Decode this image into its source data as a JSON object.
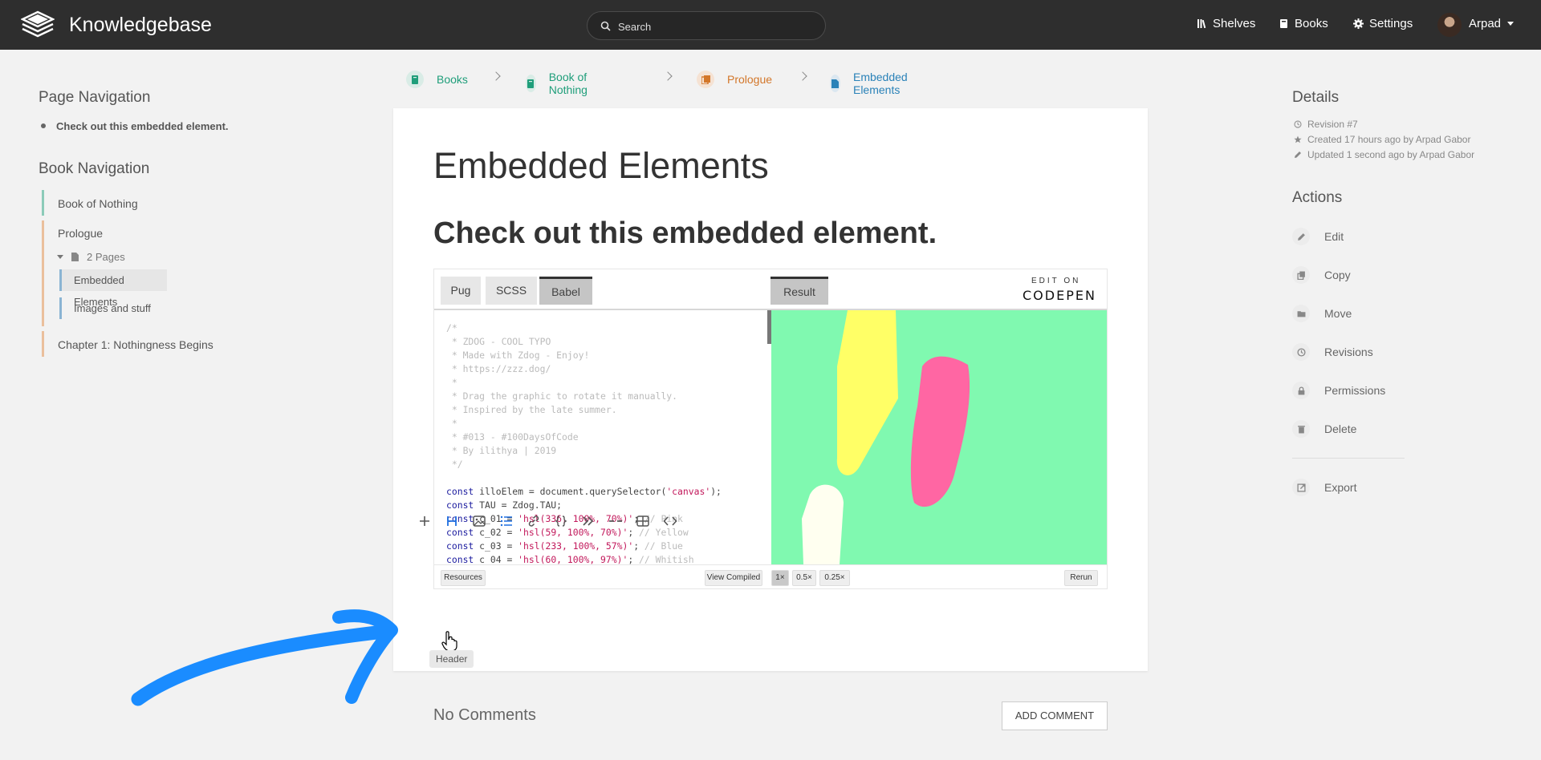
{
  "header": {
    "brand": "Knowledgebase",
    "search_placeholder": "Search",
    "nav": {
      "shelves": "Shelves",
      "books": "Books",
      "settings": "Settings"
    },
    "user": "Arpad"
  },
  "breadcrumbs": [
    "Books",
    "Book of Nothing",
    "Prologue",
    "Embedded Elements"
  ],
  "left_sidebar": {
    "page_nav_title": "Page Navigation",
    "page_nav_items": [
      "Check out this embedded element."
    ],
    "book_nav_title": "Book Navigation",
    "book": "Book of Nothing",
    "chapter_prologue": "Prologue",
    "pages_toggle": "2 Pages",
    "pages": [
      "Embedded Elements",
      "Images and stuff"
    ],
    "chapter_1": "Chapter 1: Nothingness Begins"
  },
  "page": {
    "title": "Embedded Elements",
    "heading": "Check out this embedded element."
  },
  "embed": {
    "tabs": [
      "Pug",
      "SCSS",
      "Babel"
    ],
    "active_tab": "Babel",
    "result_tab": "Result",
    "edit_on": "EDIT ON",
    "codepen": "CODEPEN",
    "code_comment": "/*\n * ZDOG - COOL TYPO\n * Made with Zdog - Enjoy!\n * https://zzz.dog/\n *\n * Drag the graphic to rotate it manually.\n * Inspired by the late summer.\n *\n * #013 - #100DaysOfCode\n * By ilithya | 2019\n */",
    "code_lines": [
      {
        "kw": "const ",
        "rest": "illoElem = document.querySelector(",
        "str": "'canvas'",
        "end": ");",
        "cmt": ""
      },
      {
        "kw": "const ",
        "rest": "TAU = Zdog.TAU;",
        "str": "",
        "end": "",
        "cmt": ""
      },
      {
        "kw": "const ",
        "rest": "c_01 = ",
        "str": "'hsl(336, 100%, 70%)'",
        "end": ";",
        "cmt": " // Pink"
      },
      {
        "kw": "const ",
        "rest": "c_02 = ",
        "str": "'hsl(59, 100%, 70%)'",
        "end": ";",
        "cmt": " // Yellow"
      },
      {
        "kw": "const ",
        "rest": "c_03 = ",
        "str": "'hsl(233, 100%, 57%)'",
        "end": ";",
        "cmt": " // Blue"
      },
      {
        "kw": "const ",
        "rest": "c_04 = ",
        "str": "'hsl(60, 100%, 97%)'",
        "end": ";",
        "cmt": " // Whitish"
      }
    ],
    "footer": {
      "resources": "Resources",
      "view_compiled": "View Compiled",
      "zoom": [
        "1×",
        "0.5×",
        "0.25×"
      ],
      "active_zoom": "1×",
      "rerun": "Rerun"
    },
    "colors": {
      "result_bg": "#80f9b0",
      "pink": "#ff66a3",
      "yellow": "#ffff66",
      "whitish": "#fffff0"
    }
  },
  "toolbar": {
    "items": [
      "plus-icon",
      "header-icon",
      "image-icon",
      "list-icon",
      "link-icon",
      "code-braces-icon",
      "quote-icon",
      "divider-icon",
      "table-icon",
      "embed-icon"
    ],
    "tooltip": "Header"
  },
  "comments": {
    "empty": "No Comments",
    "add": "ADD COMMENT"
  },
  "right_sidebar": {
    "details_title": "Details",
    "revision": "Revision #7",
    "created": "Created 17 hours ago by Arpad Gabor",
    "updated": "Updated 1 second ago by Arpad Gabor",
    "actions_title": "Actions",
    "actions": [
      "Edit",
      "Copy",
      "Move",
      "Revisions",
      "Permissions",
      "Delete"
    ],
    "export": "Export"
  },
  "colors": {
    "header_bg": "#2e2e2e",
    "book": "#1f9e7a",
    "chapter": "#d3772a",
    "page": "#2a82b8",
    "annotation_arrow": "#1a8cff"
  }
}
